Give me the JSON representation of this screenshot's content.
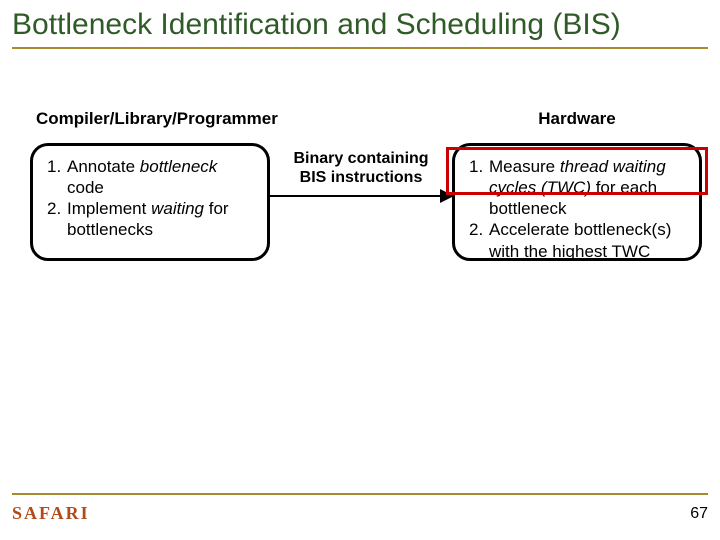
{
  "title": "Bottleneck Identification and Scheduling (BIS)",
  "columns": {
    "left": "Compiler/Library/Programmer",
    "right": "Hardware"
  },
  "left_box": {
    "items": [
      {
        "num": "1.",
        "pre": "Annotate ",
        "it": "bottleneck",
        "post": " code"
      },
      {
        "num": "2.",
        "pre": "Implement ",
        "it": "waiting",
        "post": " for bottlenecks"
      }
    ]
  },
  "arrow_label": {
    "line1": "Binary containing",
    "line2": "BIS instructions"
  },
  "right_box": {
    "items": [
      {
        "num": "1.",
        "pre": "Measure ",
        "it": "thread waiting cycles (TWC)",
        "post": " for each bottleneck"
      },
      {
        "num": "2.",
        "pre": "Accelerate bottleneck(s) with the highest TWC",
        "it": "",
        "post": ""
      }
    ]
  },
  "footer": {
    "logo": "SAFARI",
    "page": "67"
  }
}
